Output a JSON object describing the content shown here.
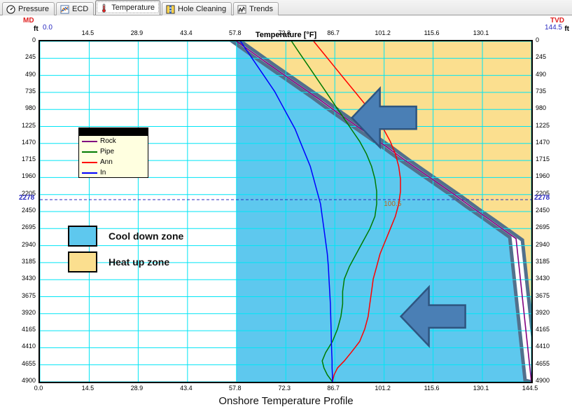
{
  "tabs": [
    {
      "label": "Pressure",
      "icon": "gauge-icon",
      "active": false
    },
    {
      "label": "ECD",
      "icon": "ecd-chart-icon",
      "active": false
    },
    {
      "label": "Temperature",
      "icon": "thermometer-icon",
      "active": true
    },
    {
      "label": "Hole Cleaning",
      "icon": "hole-cleaning-icon",
      "active": false
    },
    {
      "label": "Trends",
      "icon": "trends-chart-icon",
      "active": false
    }
  ],
  "toolbar": {
    "items": [
      {
        "name": "grid-view-button",
        "icon": "grid-icon"
      },
      {
        "name": "zoom-button",
        "icon": "magnifier-icon"
      },
      {
        "name": "select-points-button",
        "icon": "crosshair-pointer-icon"
      },
      {
        "name": "clear-button",
        "icon": "blue-x-icon"
      },
      {
        "name": "curve-tool-button",
        "icon": "black-curve-icon"
      },
      {
        "name": "legend-button",
        "icon": "legend-list-icon"
      },
      {
        "name": "markers-button",
        "icon": "markers-icon"
      },
      {
        "name": "regression-button",
        "icon": "fx-regression-icon"
      },
      {
        "name": "pan-button",
        "icon": "pan-arrows-icon"
      },
      {
        "name": "snapshot-button",
        "icon": "camera-icon"
      },
      {
        "name": "export-button",
        "icon": "export-page-icon"
      }
    ]
  },
  "chart_data": {
    "type": "line",
    "title": "Temperature  [°F]",
    "caption": "Onshore Temperature Profile",
    "xlabel": "Temperature  [°F]",
    "xlim": [
      0.0,
      144.5
    ],
    "xticks": [
      "0.0",
      "14.5",
      "28.9",
      "43.4",
      "57.8",
      "72.3",
      "86.7",
      "101.2",
      "115.6",
      "130.1",
      "144.5"
    ],
    "xtick_values": [
      0.0,
      14.5,
      28.9,
      43.4,
      57.8,
      72.3,
      86.7,
      101.2,
      115.6,
      130.1,
      144.5
    ],
    "left_axis": {
      "name": "MD",
      "units": "ft",
      "min": 0,
      "max": 4900,
      "ticks": [
        "0",
        "245",
        "490",
        "735",
        "980",
        "1225",
        "1470",
        "1715",
        "1960",
        "2205",
        "2450",
        "2695",
        "2940",
        "3185",
        "3430",
        "3675",
        "3920",
        "4165",
        "4410",
        "4655",
        "4900"
      ],
      "tick_values": [
        0,
        245,
        490,
        735,
        980,
        1225,
        1470,
        1715,
        1960,
        2205,
        2450,
        2695,
        2940,
        3185,
        3430,
        3675,
        3920,
        4165,
        4410,
        4655,
        4900
      ],
      "color": "#e02020"
    },
    "right_axis": {
      "name": "TVD",
      "units": "ft",
      "min": 0,
      "max": 4900,
      "ticks": [
        "0",
        "245",
        "490",
        "735",
        "980",
        "1225",
        "1470",
        "1715",
        "1960",
        "2205",
        "2450",
        "2695",
        "2940",
        "3185",
        "3430",
        "3675",
        "3920",
        "4165",
        "4410",
        "4655",
        "4900"
      ],
      "tick_values": [
        0,
        245,
        490,
        735,
        980,
        1225,
        1470,
        1715,
        1960,
        2205,
        2450,
        2695,
        2940,
        3185,
        3430,
        3675,
        3920,
        4165,
        4410,
        4655,
        4900
      ],
      "color": "#e02020"
    },
    "marker_line": {
      "label": "2278",
      "value": 2278,
      "data_label": "100.5",
      "color": "#2a2ac0"
    },
    "legend": {
      "position": "upper-left",
      "entries": [
        {
          "label": "Rock",
          "color": "#800080"
        },
        {
          "label": "Pipe",
          "color": "#007a00"
        },
        {
          "label": "Ann",
          "color": "#ff0000"
        },
        {
          "label": "In",
          "color": "#0000ff"
        }
      ]
    },
    "zones": [
      {
        "label": "Cool down zone",
        "color": "#5ec8ee"
      },
      {
        "label": "Heat up zone",
        "color": "#fbdf8f"
      }
    ],
    "annotations": [
      {
        "name": "upper-left-arrow",
        "type": "arrow",
        "direction": "left",
        "color": "#4a7fb5",
        "x": 101.2,
        "y": 1100
      },
      {
        "name": "lower-left-arrow",
        "type": "arrow",
        "direction": "left",
        "color": "#4a7fb5",
        "x": 115.6,
        "y": 3960
      }
    ],
    "series": [
      {
        "name": "Rock",
        "color": "#800080",
        "x": [
          57.8,
          62,
          67,
          72,
          77,
          82,
          87,
          92,
          97,
          102,
          107,
          112,
          117,
          122,
          127,
          132,
          136,
          140,
          144.5
        ],
        "y": [
          0,
          145,
          320,
          490,
          660,
          830,
          1010,
          1180,
          1350,
          1520,
          1700,
          1870,
          2040,
          2210,
          2390,
          2560,
          2700,
          2840,
          4900
        ]
      },
      {
        "name": "Pipe",
        "color": "#007a00",
        "x": [
          74.0,
          76.5,
          79.0,
          81.5,
          84.0,
          86.5,
          89.0,
          91.5,
          94.0,
          96.0,
          97.5,
          98.5,
          99.0,
          99.0,
          98.5,
          97.0,
          95.0,
          93.0,
          91.0,
          89.5,
          89.0,
          89.0,
          88.5,
          87.5,
          86.0,
          84.0,
          83.0,
          83.5,
          84.5,
          86.0
        ],
        "y": [
          0,
          180,
          360,
          540,
          720,
          900,
          1080,
          1260,
          1440,
          1620,
          1800,
          1980,
          2160,
          2340,
          2520,
          2700,
          2880,
          3060,
          3240,
          3420,
          3600,
          3780,
          3960,
          4140,
          4320,
          4480,
          4600,
          4700,
          4800,
          4900
        ]
      },
      {
        "name": "Ann",
        "color": "#ff0000",
        "x": [
          80.5,
          83.5,
          86.5,
          89.5,
          92.5,
          95.5,
          98.5,
          101.0,
          103.0,
          104.5,
          105.5,
          106.0,
          106.0,
          105.5,
          104.5,
          103.0,
          101.5,
          100.0,
          99.0,
          98.0,
          97.5,
          97.0,
          96.5,
          95.5,
          94.0,
          91.5,
          89.5,
          87.5,
          86.5,
          86.0
        ],
        "y": [
          0,
          180,
          360,
          540,
          720,
          900,
          1080,
          1260,
          1440,
          1620,
          1800,
          1980,
          2160,
          2340,
          2520,
          2700,
          2880,
          3060,
          3240,
          3420,
          3600,
          3780,
          3960,
          4140,
          4320,
          4480,
          4600,
          4700,
          4800,
          4900
        ]
      },
      {
        "name": "In",
        "color": "#0000ff",
        "x": [
          59.0,
          61.5,
          64.0,
          66.5,
          69.0,
          71.0,
          73.0,
          75.0,
          76.5,
          78.0,
          79.5,
          80.5,
          81.5,
          82.5,
          83.0,
          83.5,
          84.0,
          84.5,
          84.8,
          85.0,
          85.2,
          85.4,
          85.5,
          85.6,
          85.7,
          85.8,
          85.9,
          85.9,
          86.0,
          86.0
        ],
        "y": [
          0,
          180,
          360,
          540,
          720,
          900,
          1080,
          1260,
          1440,
          1620,
          1800,
          1980,
          2160,
          2340,
          2520,
          2700,
          2880,
          3060,
          3240,
          3420,
          3600,
          3780,
          3960,
          4140,
          4320,
          4480,
          4600,
          4700,
          4800,
          4900
        ]
      }
    ]
  }
}
